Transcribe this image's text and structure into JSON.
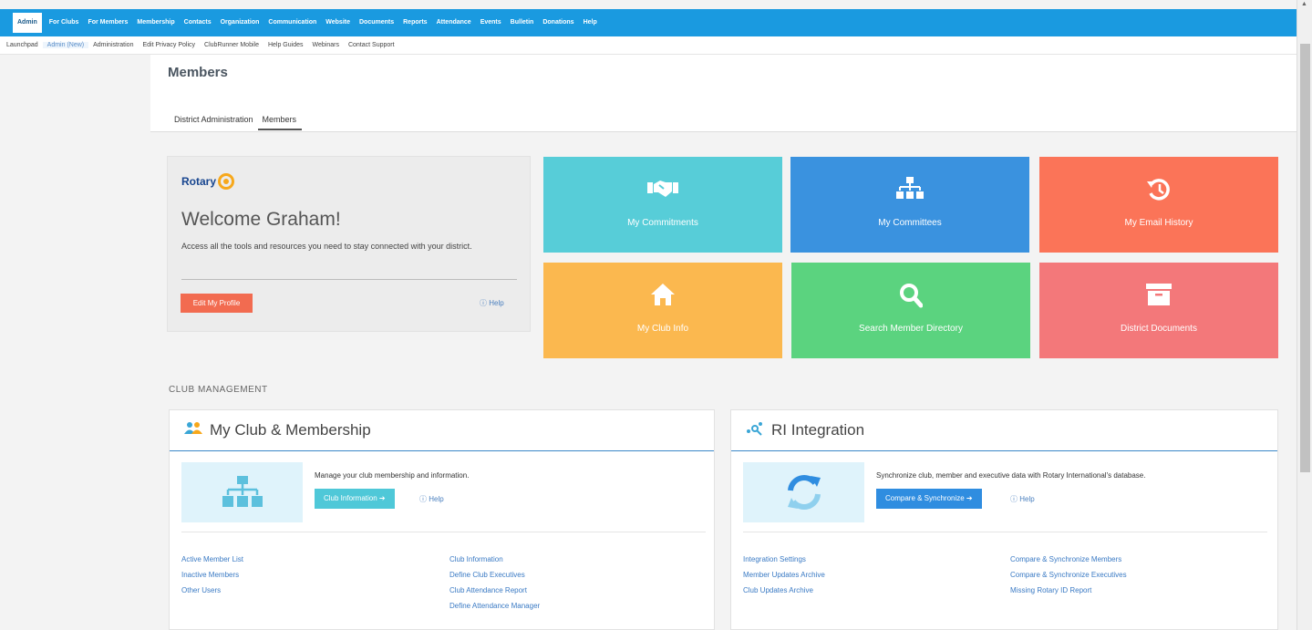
{
  "top_nav": [
    "Admin",
    "For Clubs",
    "For Members",
    "Membership",
    "Contacts",
    "Organization",
    "Communication",
    "Website",
    "Documents",
    "Reports",
    "Attendance",
    "Events",
    "Bulletin",
    "Donations",
    "Help"
  ],
  "sub_nav": [
    "Launchpad",
    "Admin (New)",
    "Administration",
    "Edit Privacy Policy",
    "ClubRunner Mobile",
    "Help Guides",
    "Webinars",
    "Contact Support"
  ],
  "page_title": "Members",
  "tabs": [
    "District Administration",
    "Members"
  ],
  "welcome": {
    "logo_text": "Rotary",
    "greeting": "Welcome Graham!",
    "description": "Access all the tools and resources you need to stay connected with your district.",
    "edit_button": "Edit My Profile",
    "help": "Help"
  },
  "tiles": [
    {
      "label": "My Commitments",
      "icon": "handshake-icon",
      "color": "#57cdd8"
    },
    {
      "label": "My Committees",
      "icon": "org-chart-icon",
      "color": "#3a92df"
    },
    {
      "label": "My Email History",
      "icon": "history-icon",
      "color": "#fb7458"
    },
    {
      "label": "My Club Info",
      "icon": "home-icon",
      "color": "#fbb84f"
    },
    {
      "label": "Search Member Directory",
      "icon": "search-icon",
      "color": "#5bd37f"
    },
    {
      "label": "District Documents",
      "icon": "archive-icon",
      "color": "#f3787a"
    }
  ],
  "section_label": "CLUB MANAGEMENT",
  "panels": [
    {
      "title": "My Club & Membership",
      "icon": "members-icon",
      "description": "Manage your club membership and information.",
      "button": "Club Information ➔",
      "button_color": "#4fc8d8",
      "help": "Help",
      "col1": [
        "Active Member List",
        "Inactive Members",
        "Other Users"
      ],
      "col2": [
        "Club Information",
        "Define Club Executives",
        "Club Attendance Report",
        "Define Attendance Manager"
      ]
    },
    {
      "title": "RI Integration",
      "icon": "integration-icon",
      "description": "Synchronize club, member and executive data with Rotary International's database.",
      "button": "Compare & Synchronize ➔",
      "button_color": "#2f8de0",
      "help": "Help",
      "col1": [
        "Integration Settings",
        "Member Updates Archive",
        "Club Updates Archive"
      ],
      "col2": [
        "Compare & Synchronize Members",
        "Compare & Synchronize Executives",
        "Missing Rotary ID Report"
      ]
    }
  ]
}
